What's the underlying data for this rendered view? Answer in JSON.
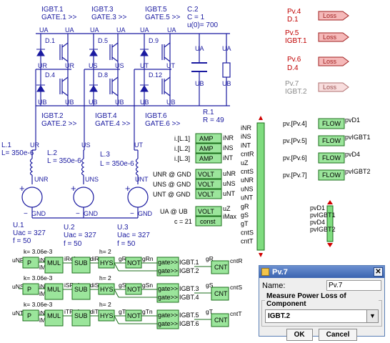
{
  "switches": [
    {
      "name": "IGBT.1",
      "gate": "GATE.1 >>",
      "diode": "D.1",
      "t1": "UA",
      "t2": "UA"
    },
    {
      "name": "IGBT.3",
      "gate": "GATE.3 >>",
      "diode": "D.5",
      "t1": "UA",
      "t2": "UA"
    },
    {
      "name": "IGBT.5",
      "gate": "GATE.5 >>",
      "diode": "D.9",
      "t1": "UA",
      "t2": "UA"
    },
    {
      "name": "IGBT.2",
      "gate": "GATE.2 >>",
      "diode": "D.4",
      "t1": "UR",
      "t2": "UR"
    },
    {
      "name": "IGBT.4",
      "gate": "GATE.4 >>",
      "diode": "D.8",
      "t1": "US",
      "t2": "US"
    },
    {
      "name": "IGBT.6",
      "gate": "GATE.6 >>",
      "diode": "D.12",
      "t1": "UT",
      "t2": "UT"
    }
  ],
  "bottom_terms": [
    "UB",
    "UB",
    "UB",
    "UB",
    "UB",
    "UB"
  ],
  "capacitor": {
    "name": "C.2",
    "value": "C = 1",
    "init": "u(0)= 700",
    "top": "UA",
    "bottom": "UB"
  },
  "resistor": {
    "name": "R.1",
    "value": "R = 49",
    "top": "UA",
    "bottom": "UB"
  },
  "inductors": [
    {
      "name": "L.1",
      "value": "L= 350e-6",
      "top": "UR",
      "bottom": "UNR"
    },
    {
      "name": "L.2",
      "value": "L = 350e-6",
      "top": "US",
      "bottom": "UNS"
    },
    {
      "name": "L.3",
      "value": "L = 350e-6",
      "top": "UT",
      "bottom": "UNT"
    }
  ],
  "sources": [
    {
      "name": "U.1",
      "uac": "Uac = 327",
      "f": "f = 50"
    },
    {
      "name": "U.2",
      "uac": "Uac = 327",
      "f": "f = 50"
    },
    {
      "name": "U.3",
      "uac": "Uac = 327",
      "f": "f = 50"
    }
  ],
  "gnd": "GND",
  "plus": "+",
  "minus": "−",
  "loss_blocks": [
    {
      "pv": "Pv.4",
      "comp": "D.1",
      "label": "Loss",
      "disabled": false
    },
    {
      "pv": "Pv.5",
      "comp": "IGBT.1",
      "label": "Loss",
      "disabled": false
    },
    {
      "pv": "Pv.6",
      "comp": "D.4",
      "label": "Loss",
      "disabled": false
    },
    {
      "pv": "Pv.7",
      "comp": "IGBT.2",
      "label": "Loss",
      "disabled": true
    }
  ],
  "meters": [
    {
      "input": "i.[L.1]",
      "type": "AMP",
      "out": "iNR"
    },
    {
      "input": "i.[L.2]",
      "type": "AMP",
      "out": "iNS"
    },
    {
      "input": "i.[L.3]",
      "type": "AMP",
      "out": "iNT"
    },
    {
      "input": "UNR @ GND",
      "type": "VOLT",
      "out": "uNR"
    },
    {
      "input": "UNS @ GND",
      "type": "VOLT",
      "out": "uNS"
    },
    {
      "input": "UNT @ GND",
      "type": "VOLT",
      "out": "uNT"
    }
  ],
  "ua_volt": {
    "input": "UA @ UB",
    "type": "VOLT",
    "out": "uZ"
  },
  "const_block": {
    "input": "c = 21",
    "type": "const",
    "out": "iMax"
  },
  "bus_labels": [
    "iNR",
    "iNS",
    "iNT",
    "cntR",
    "uZ",
    "cntS",
    "uNR",
    "uNS",
    "uNT",
    "gR",
    "gS",
    "gT",
    "cntS",
    "cntT"
  ],
  "flows": [
    {
      "input": "pv.[Pv.4]",
      "label": "FLOW",
      "out": "pvD1"
    },
    {
      "input": "pv.[Pv.5]",
      "label": "FLOW",
      "out": "pvIGBT1"
    },
    {
      "input": "pv.[Pv.6]",
      "label": "FLOW",
      "out": "pvD4"
    },
    {
      "input": "pv.[Pv.7]",
      "label": "FLOW",
      "out": "pvIGBT2"
    }
  ],
  "mux_labels": [
    "pvD1",
    "pvIGBT1",
    "pvD4",
    "pvIGBT2"
  ],
  "control_rows": [
    {
      "k": "k= 3.06e-3",
      "in1": "uNR",
      "in2": "iNR",
      "p": "P",
      "mul": "MUL",
      "imax": "iMax",
      "sub": "SUB",
      "h": "h= 2",
      "hys": "HYS",
      "not": "NOT",
      "gate": "gate>>",
      "g1": "IGBT.1",
      "g2": "IGBT.2",
      "cnt_in": "gR",
      "cnt": "CNT",
      "cnt_out": "cntR",
      "sig1": "iRef",
      "sig2": "diR",
      "sig3": "gR",
      "sig4": "gRn"
    },
    {
      "k": "k= 3.06e-3",
      "in1": "uNS",
      "in2": "iNS",
      "p": "P",
      "mul": "MUL",
      "imax": "iMax",
      "sub": "SUB",
      "h": "h= 2",
      "hys": "HYS",
      "not": "NOT",
      "gate": "gate>>",
      "g1": "IGBT.3",
      "g2": "IGBT.4",
      "cnt_in": "gS",
      "cnt": "CNT",
      "cnt_out": "cntS",
      "sig1": "iSRef",
      "sig2": "diS",
      "sig3": "gS",
      "sig4": "gSn"
    },
    {
      "k": "k= 3.06e-3",
      "in1": "uNT",
      "in2": "iNT",
      "p": "P",
      "mul": "MUL",
      "imax": "iMax",
      "sub": "SUB",
      "h": "h= 2",
      "hys": "HYS",
      "not": "NOT",
      "gate": "gate>>",
      "g1": "IGBT.5",
      "g2": "IGBT.6",
      "cnt_in": "gT",
      "cnt": "CNT",
      "cnt_out": "cntT",
      "sig1": "iTRef",
      "sig2": "diT",
      "sig3": "gT",
      "sig4": "gTn"
    }
  ],
  "dialog": {
    "title": "Pv.7",
    "name_label": "Name:",
    "name_value": "Pv.7",
    "group_label": "Measure Power Loss of Component",
    "selected": "IGBT.2",
    "ok": "OK",
    "cancel": "Cancel",
    "close": "✕"
  },
  "colors": {
    "wire": "#1a1aa0",
    "block_fill": "#9be59b",
    "block_stroke": "#1b6e1b",
    "loss_fill": "#f5b9b9",
    "loss_stroke": "#a02020",
    "arrow": "#d00000",
    "bus_fill": "#7fdc7f"
  }
}
